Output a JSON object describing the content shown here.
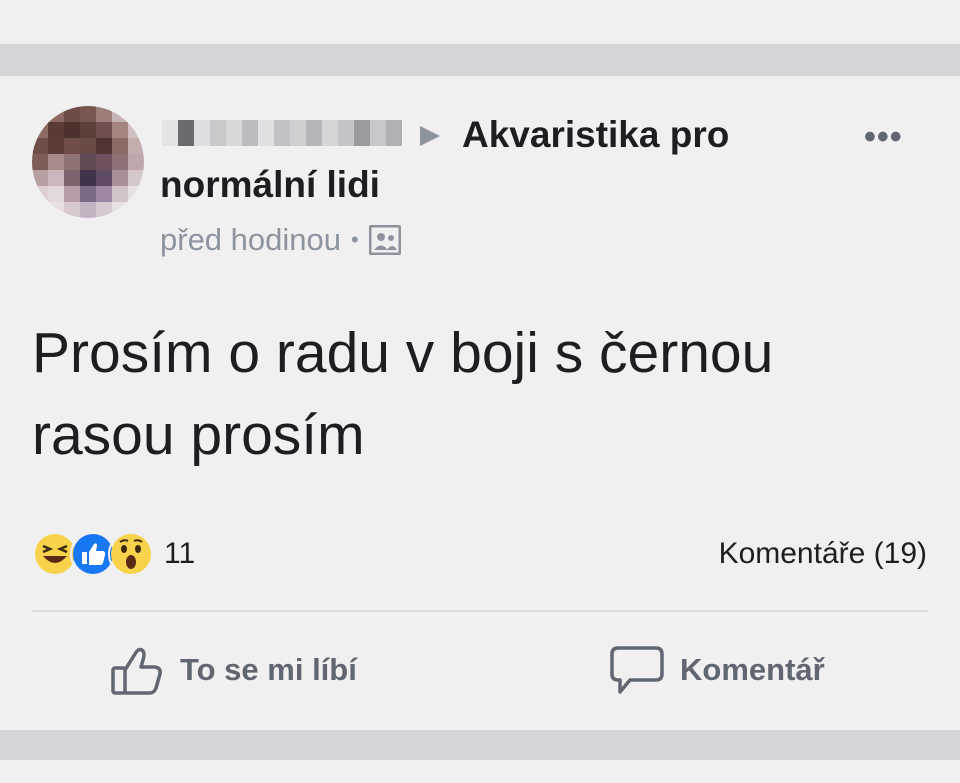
{
  "post": {
    "group_name": "Akvaristika pro normální lidi",
    "time": "před hodinou",
    "separator": "•",
    "privacy_icon": "group-members-icon",
    "text": "Prosím o radu v boji s černou rasou prosím",
    "more_label": "•••"
  },
  "stats": {
    "reactions": [
      "haha",
      "like",
      "wow"
    ],
    "reaction_count": "11",
    "comments_label": "Komentáře (19)"
  },
  "actions": {
    "like_label": "To se mi líbí",
    "comment_label": "Komentář"
  },
  "colors": {
    "like_blue": "#1877f2",
    "emoji_yellow": "#f7d24a",
    "muted_text": "#8d949e",
    "action_text": "#606770"
  }
}
